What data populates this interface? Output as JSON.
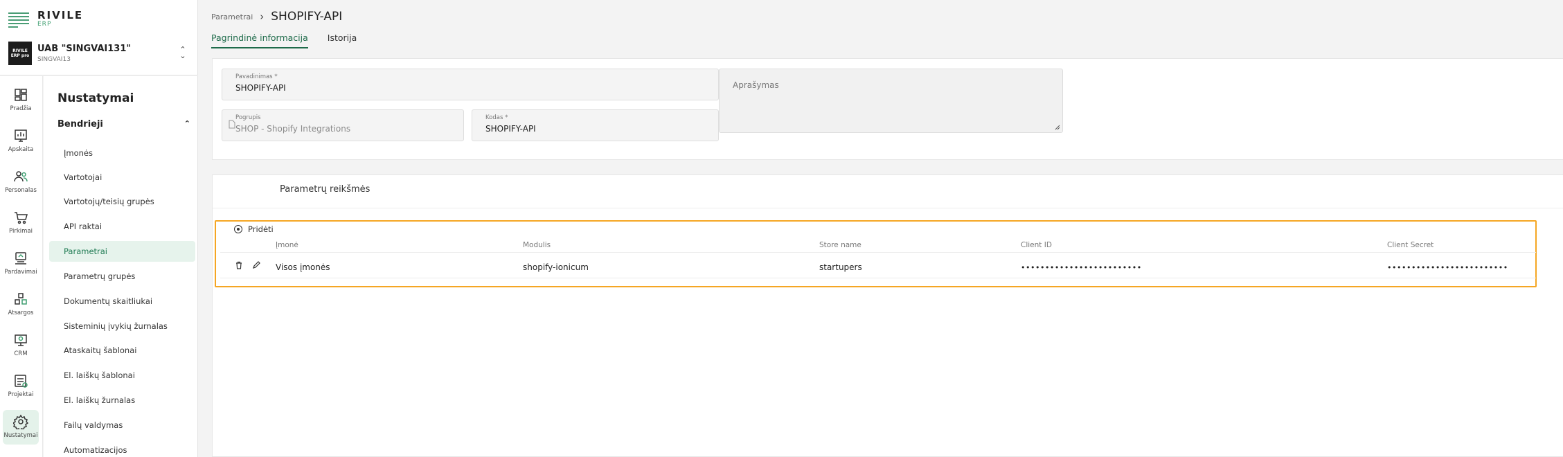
{
  "app": {
    "brand": "RIVILE",
    "brand_sub": "ERP"
  },
  "company": {
    "name": "UAB \"SINGVAI131\"",
    "code": "SINGVAI13",
    "avatar_text_1": "RIVILE",
    "avatar_text_2": "ERP pro"
  },
  "rail": [
    {
      "label": "Pradžia",
      "icon": "home-dashboard-icon"
    },
    {
      "label": "Apskaita",
      "icon": "accounting-chart-icon"
    },
    {
      "label": "Personalas",
      "icon": "people-icon"
    },
    {
      "label": "Pirkimai",
      "icon": "cart-icon"
    },
    {
      "label": "Pardavimai",
      "icon": "sales-icon"
    },
    {
      "label": "Atsargos",
      "icon": "inventory-icon"
    },
    {
      "label": "CRM",
      "icon": "crm-icon"
    },
    {
      "label": "Projektai",
      "icon": "projects-icon"
    },
    {
      "label": "Nustatymai",
      "icon": "settings-gear-icon"
    }
  ],
  "subnav": {
    "title": "Nustatymai",
    "group": "Bendrieji",
    "items": [
      "Įmonės",
      "Vartotojai",
      "Vartotojų/teisių grupės",
      "API raktai",
      "Parametrai",
      "Parametrų grupės",
      "Dokumentų skaitliukai",
      "Sisteminių įvykių žurnalas",
      "Ataskaitų šablonai",
      "El. laiškų šablonai",
      "El. laiškų žurnalas",
      "Failų valdymas",
      "Automatizacijos"
    ],
    "active_index": 4
  },
  "breadcrumb": {
    "parent": "Parametrai",
    "current": "SHOPIFY-API"
  },
  "tabs": [
    "Pagrindinė informacija",
    "Istorija"
  ],
  "form": {
    "name_label": "Pavadinimas *",
    "name_value": "SHOPIFY-API",
    "description_placeholder": "Aprašymas",
    "subgroup_label": "Pogrupis",
    "subgroup_value": "SHOP - Shopify Integrations",
    "code_label": "Kodas *",
    "code_value": "SHOPIFY-API"
  },
  "params": {
    "title": "Parametrų reikšmės",
    "add_label": "Pridėti",
    "columns": [
      "Įmonė",
      "Modulis",
      "Store name",
      "Client ID",
      "Client Secret"
    ],
    "rows": [
      {
        "company": "Visos įmonės",
        "module": "shopify-ionicum",
        "store": "startupers",
        "client_id": "•••••••••••••••••••••••••",
        "client_secret": "•••••••••••••••••••••••••"
      }
    ]
  },
  "colors": {
    "accent": "#1e6b4a",
    "highlight": "#f5a623",
    "active_bg": "#e6f3ec"
  }
}
